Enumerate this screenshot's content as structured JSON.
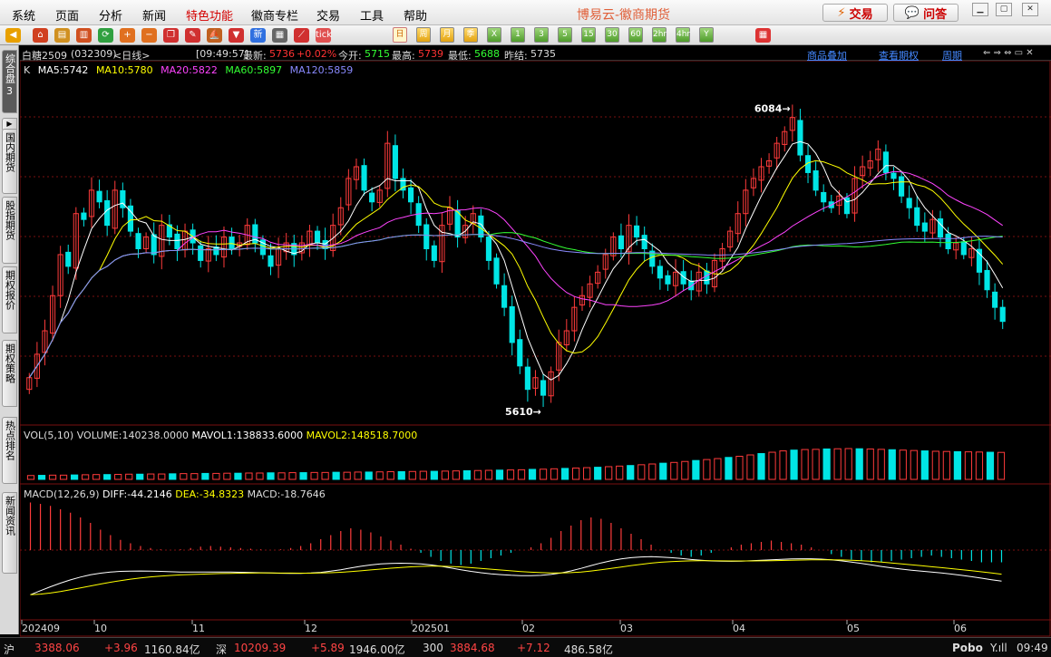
{
  "menubar": {
    "items": [
      {
        "label": "系统",
        "hl": false
      },
      {
        "label": "页面",
        "hl": false
      },
      {
        "label": "分析",
        "hl": false
      },
      {
        "label": "新闻",
        "hl": false
      },
      {
        "label": "特色功能",
        "hl": true
      },
      {
        "label": "徽商专栏",
        "hl": false
      },
      {
        "label": "交易",
        "hl": false
      },
      {
        "label": "工具",
        "hl": false
      },
      {
        "label": "帮助",
        "hl": false
      }
    ],
    "app_title": "博易云-徽商期货",
    "trade_label": "交易",
    "ask_label": "问答"
  },
  "toolbar": {
    "icons": [
      {
        "name": "back-arrow-icon",
        "glyph": "◀",
        "color": "#e8a000"
      },
      {
        "name": "home-icon",
        "glyph": "⌂",
        "color": "#d04020"
      },
      {
        "name": "database-icon",
        "glyph": "▤",
        "color": "#d09020"
      },
      {
        "name": "chart-report-icon",
        "glyph": "▥",
        "color": "#d05020"
      },
      {
        "name": "refresh-icon",
        "glyph": "⟳",
        "color": "#30a040"
      },
      {
        "name": "zoom-in-icon",
        "glyph": "+",
        "color": "#e07020"
      },
      {
        "name": "zoom-out-icon",
        "glyph": "−",
        "color": "#e07020"
      },
      {
        "name": "windows-icon",
        "glyph": "❐",
        "color": "#d03030"
      },
      {
        "name": "pencil-icon",
        "glyph": "✎",
        "color": "#d03030"
      },
      {
        "name": "ship-icon",
        "glyph": "⛵",
        "color": "#c06020"
      },
      {
        "name": "filter-icon",
        "glyph": "▼",
        "color": "#d03030"
      },
      {
        "name": "news-icon",
        "glyph": "新",
        "color": "#3070e0"
      },
      {
        "name": "table-icon",
        "glyph": "▦",
        "color": "#666666"
      },
      {
        "name": "trend-icon",
        "glyph": "⟋",
        "color": "#d03030"
      },
      {
        "name": "tick-icon",
        "glyph": "tick",
        "color": "#e05050"
      }
    ],
    "periods": [
      "日",
      "周",
      "月",
      "季",
      "X",
      "1",
      "3",
      "5",
      "15",
      "30",
      "60",
      "2hr",
      "4hr",
      "Y"
    ],
    "selected_period": "日"
  },
  "left_tabs": [
    {
      "label": "综合盘",
      "arrow": "3"
    },
    {
      "label": "国内期货"
    },
    {
      "label": "股指期货"
    },
    {
      "label": "期权报价"
    },
    {
      "label": "期权策略"
    },
    {
      "label": "热点排名"
    },
    {
      "label": "新闻资讯"
    }
  ],
  "info": {
    "title": "白糖2509",
    "code": "(032309)",
    "period": "<日线>",
    "time": "[09:49:57]",
    "latest_label": "最新:",
    "latest_value": "5736",
    "change": "+0.02%",
    "open_label": "今开:",
    "open_value": "5715",
    "high_label": "最高:",
    "high_value": "5739",
    "low_label": "最低:",
    "low_value": "5688",
    "prev_label": "昨结:",
    "prev_value": "5735",
    "links": [
      "商品叠加",
      "查看期权",
      "周期"
    ]
  },
  "ma": [
    {
      "label": "MA5:5742",
      "color": "#ffffff"
    },
    {
      "label": "MA10:5780",
      "color": "#ffff00"
    },
    {
      "label": "MA20:5822",
      "color": "#ff44ff"
    },
    {
      "label": "MA60:5897",
      "color": "#33ff33"
    },
    {
      "label": "MA120:5859",
      "color": "#8a8aff"
    }
  ],
  "volume": {
    "label": "VOL(5,10)",
    "value": "VOLUME:140238.0000",
    "mavol1": "MAVOL1:138833.6000",
    "mavol2": "MAVOL2:148518.7000"
  },
  "macd": {
    "label": "MACD(12,26,9)",
    "diff": "DIFF:-44.2146",
    "dea": "DEA:-34.8323",
    "macd": "MACD:-18.7646"
  },
  "chart_data": {
    "type": "candlestick",
    "instrument": "白糖2509",
    "price_ylim": [
      5570,
      6150
    ],
    "annotations": [
      {
        "label": "6084",
        "value": 6084
      },
      {
        "label": "5610",
        "value": 5610
      }
    ],
    "x_ticks": [
      "202409",
      "10",
      "11",
      "12",
      "202501",
      "02",
      "03",
      "04",
      "05",
      "06"
    ],
    "closes": [
      5640,
      5680,
      5720,
      5780,
      5850,
      5830,
      5920,
      5910,
      5960,
      5940,
      5900,
      5960,
      5930,
      5890,
      5860,
      5880,
      5850,
      5900,
      5880,
      5860,
      5890,
      5870,
      5840,
      5860,
      5850,
      5880,
      5860,
      5870,
      5900,
      5870,
      5850,
      5830,
      5860,
      5870,
      5850,
      5870,
      5890,
      5870,
      5860,
      5900,
      5930,
      5980,
      6000,
      5960,
      5940,
      5960,
      6040,
      5980,
      5960,
      5940,
      5900,
      5860,
      5840,
      5900,
      5930,
      5880,
      5900,
      5920,
      5880,
      5840,
      5800,
      5760,
      5700,
      5660,
      5620,
      5640,
      5610,
      5650,
      5700,
      5720,
      5760,
      5780,
      5800,
      5820,
      5850,
      5880,
      5860,
      5900,
      5880,
      5860,
      5830,
      5810,
      5800,
      5820,
      5800,
      5790,
      5820,
      5800,
      5840,
      5860,
      5890,
      5920,
      5960,
      5980,
      6000,
      6010,
      6040,
      6060,
      6084,
      6020,
      5990,
      5960,
      5940,
      5930,
      5950,
      5920,
      5980,
      6000,
      6010,
      6030,
      5990,
      5980,
      5950,
      5930,
      5900,
      5890,
      5910,
      5880,
      5860,
      5870,
      5850,
      5860,
      5820,
      5790,
      5760,
      5736
    ],
    "volume_max": 160000,
    "volume_last": 140238,
    "volume_values": [
      20000,
      21000,
      22000,
      22000,
      23000,
      24000,
      25000,
      25000,
      26000,
      27000,
      27000,
      28000,
      28000,
      29000,
      30000,
      30000,
      31000,
      31000,
      32000,
      32000,
      33000,
      33000,
      34000,
      34000,
      35000,
      35000,
      36000,
      36000,
      37000,
      37000,
      38000,
      38000,
      39000,
      40000,
      40000,
      41000,
      42000,
      42000,
      43000,
      44000,
      45000,
      46000,
      47000,
      48000,
      49000,
      50000,
      52000,
      53000,
      55000,
      57000,
      59000,
      61000,
      63000,
      66000,
      69000,
      72000,
      76000,
      80000,
      84000,
      88000,
      93000,
      98000,
      103000,
      108000,
      114000,
      120000,
      127000,
      134000,
      141000,
      148000,
      152000,
      155000,
      156000,
      158000,
      159000,
      160000,
      159000,
      158000,
      156000,
      154000,
      152000,
      150000,
      148000,
      146000,
      145000,
      144000,
      143000,
      142000,
      141000,
      140238
    ],
    "macd_hist_range": [
      -40,
      80
    ],
    "macd_hist": [
      70,
      68,
      65,
      60,
      55,
      48,
      40,
      30,
      22,
      15,
      10,
      6,
      3,
      1,
      0,
      1,
      3,
      5,
      6,
      5,
      4,
      3,
      2,
      1,
      0,
      1,
      3,
      6,
      10,
      16,
      22,
      28,
      32,
      30,
      26,
      20,
      14,
      8,
      2,
      -4,
      -10,
      -16,
      -20,
      -22,
      -20,
      -16,
      -12,
      -8,
      -4,
      0,
      4,
      10,
      18,
      28,
      36,
      44,
      48,
      46,
      40,
      32,
      24,
      16,
      8,
      0,
      -4,
      -8,
      -10,
      -8,
      -4,
      0,
      4,
      8,
      10,
      12,
      14,
      12,
      10,
      8,
      4,
      0,
      -6,
      -10,
      -14,
      -16,
      -18,
      -18,
      -16,
      -14,
      -12,
      -10,
      -8,
      -10,
      -12,
      -14,
      -16,
      -18,
      -18,
      -18
    ]
  },
  "status": {
    "sh_label": "沪",
    "sh_index": "3388.06",
    "sh_change": "+3.96",
    "sh_amount": "1160.84亿",
    "sz_label": "深",
    "sz_index": "10209.39",
    "sz_change": "+5.89",
    "sz_amount": "1946.00亿",
    "c300_label": "300",
    "c300_index": "3884.68",
    "c300_change": "+7.12",
    "c300_amount": "486.58亿",
    "brand": "Pobo",
    "signal": "Y.ıll",
    "time": "09:49"
  }
}
